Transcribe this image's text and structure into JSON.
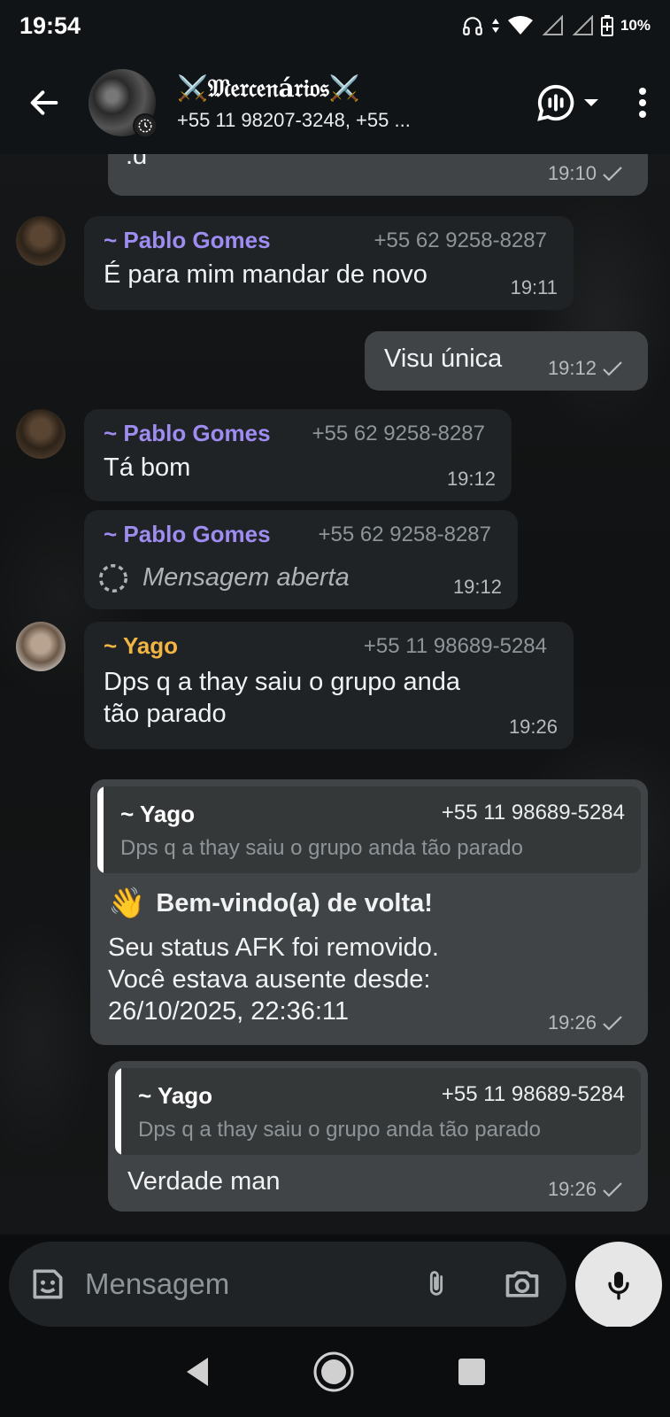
{
  "status_bar": {
    "time": "19:54",
    "battery": "10%"
  },
  "header": {
    "group_name": "⚔️𝔐𝔢𝔯𝔠𝔢𝔫á𝔯𝔦𝔬𝔰⚔️",
    "members": "+55 11 98207-3248, +55 ..."
  },
  "messages": [
    {
      "text": ".d",
      "time": "19:10"
    },
    {
      "sender": "~ Pablo Gomes",
      "phone": "+55 62 9258-8287",
      "text": "É para mim mandar de novo",
      "time": "19:11"
    },
    {
      "text": "Visu única",
      "time": "19:12"
    },
    {
      "sender": "~ Pablo Gomes",
      "phone": "+55 62 9258-8287",
      "text": "Tá bom",
      "time": "19:12"
    },
    {
      "sender": "~ Pablo Gomes",
      "phone": "+55 62 9258-8287",
      "text": "Mensagem aberta",
      "time": "19:12"
    },
    {
      "sender": "~ Yago",
      "phone": "+55 11 98689-5284",
      "text_line1": "Dps q a thay saiu o grupo anda",
      "text_line2": "tão parado",
      "time": "19:26"
    },
    {
      "quote": {
        "sender": "~ Yago",
        "phone": "+55 11 98689-5284",
        "text": "Dps q a thay saiu o grupo anda tão parado"
      },
      "emoji": "👋",
      "title": "Bem-vindo(a) de volta!",
      "line1": "Seu status AFK foi removido.",
      "line2": "Você estava ausente desde:",
      "line3": "26/10/2025, 22:36:11",
      "time": "19:26"
    },
    {
      "quote": {
        "sender": "~ Yago",
        "phone": "+55 11 98689-5284",
        "text": "Dps q a thay saiu o grupo anda tão parado"
      },
      "text": "Verdade man",
      "time": "19:26"
    }
  ],
  "composer": {
    "placeholder": "Mensagem"
  },
  "colors": {
    "pablo": "#9e8cf0",
    "yago": "#f2b443",
    "incoming": "#1f2326",
    "outgoing": "#414446"
  },
  "icons": [
    "back-arrow-icon",
    "voice-call-icon",
    "more-icon",
    "sticker-icon",
    "attach-icon",
    "camera-icon",
    "mic-icon",
    "view-once-icon",
    "check-icon"
  ]
}
